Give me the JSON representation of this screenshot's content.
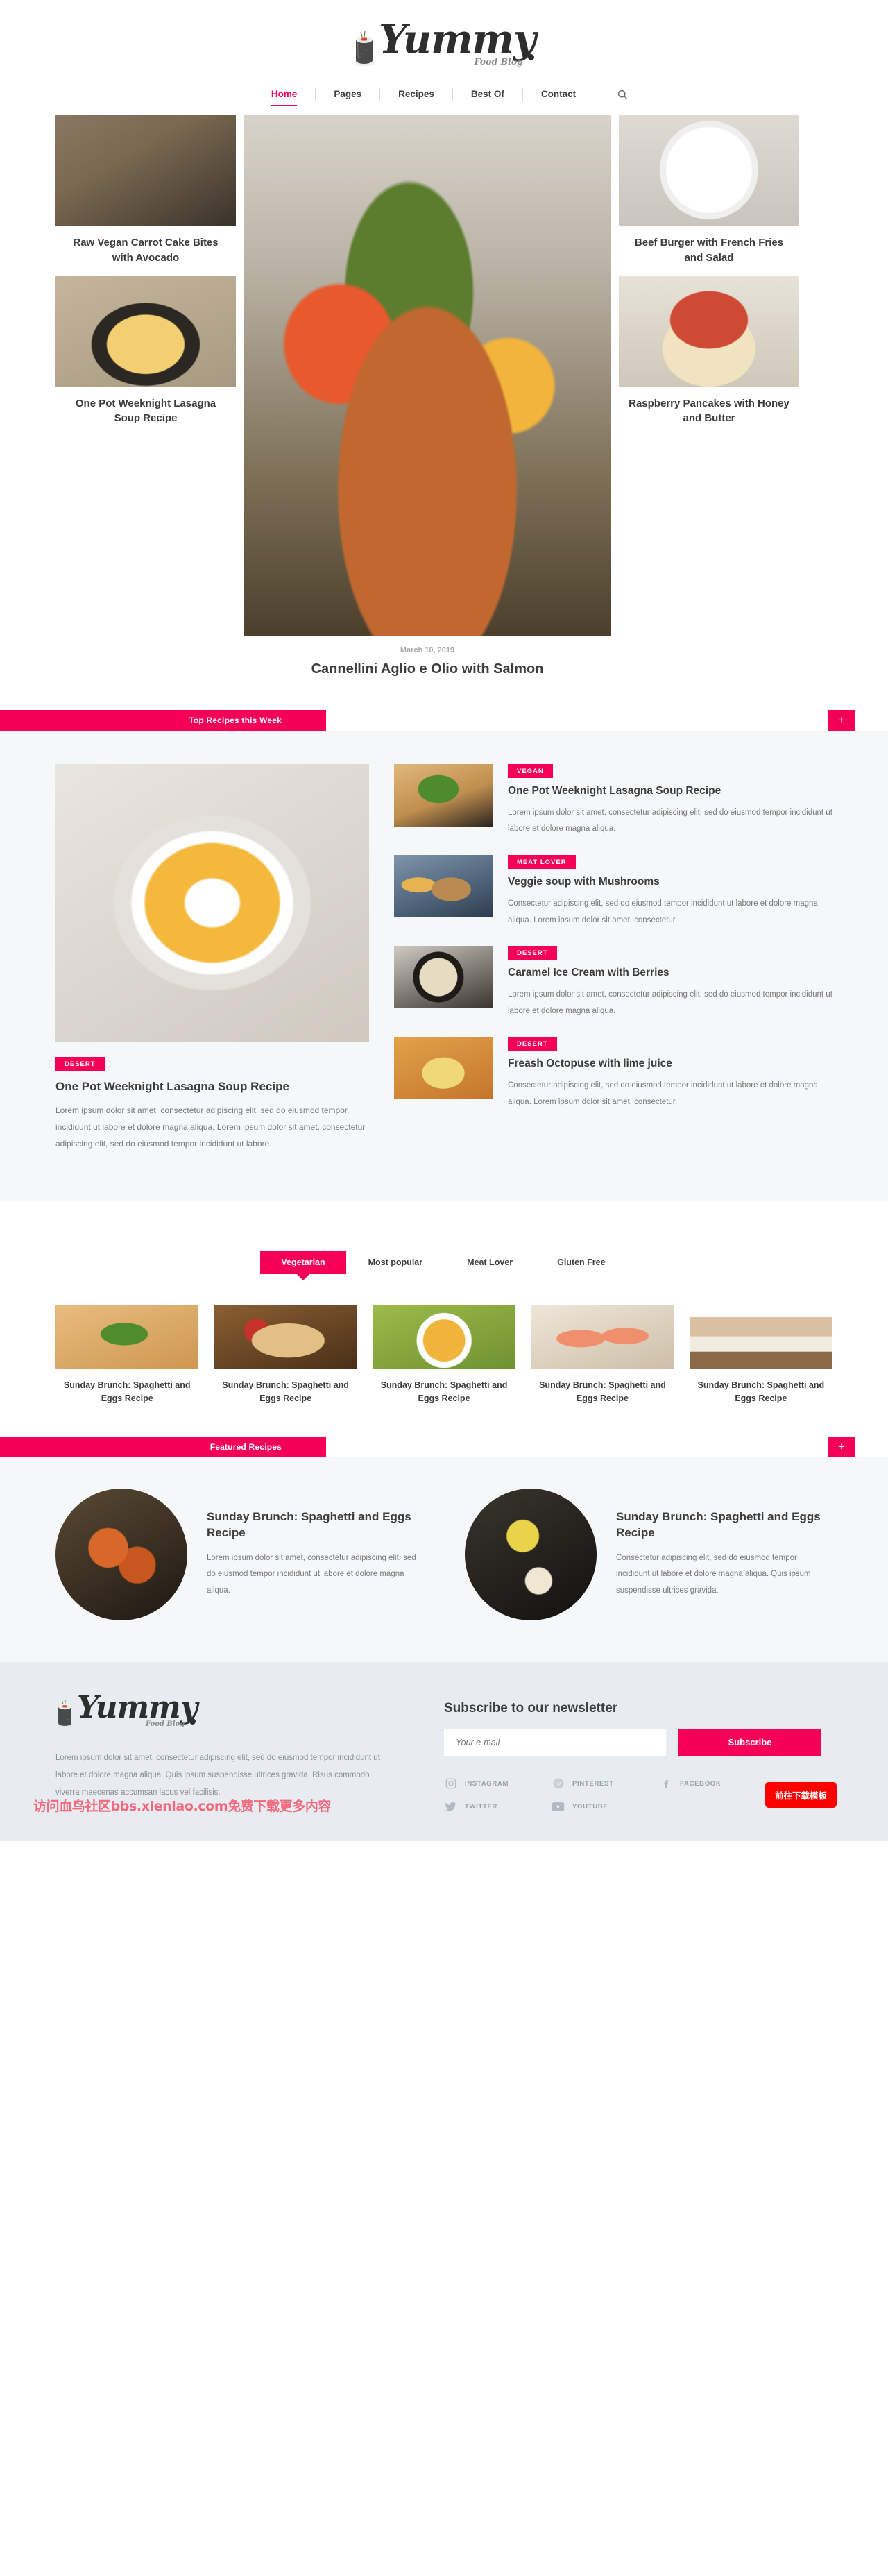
{
  "brand": {
    "name": "Yummy",
    "tagline": "Food Blog",
    "logo_icon": "sushi-roll-icon"
  },
  "nav": {
    "items": [
      {
        "label": "Home",
        "active": true
      },
      {
        "label": "Pages",
        "active": false
      },
      {
        "label": "Recipes",
        "active": false
      },
      {
        "label": "Best Of",
        "active": false
      },
      {
        "label": "Contact",
        "active": false
      }
    ],
    "search_icon": "search-icon"
  },
  "hero": {
    "left": [
      {
        "title": "Raw Vegan Carrot Cake Bites with Avocado",
        "img": "pancakes-raspberries"
      },
      {
        "title": "One Pot Weeknight Lasagna Soup Recipe",
        "img": "omelette-skillet"
      }
    ],
    "center": {
      "date": "March 10, 2019",
      "title": "Cannellini Aglio e Olio with Salmon",
      "img": "salmon-vegetables"
    },
    "right": [
      {
        "title": "Beef Burger with French Fries and Salad",
        "img": "gourmet-plate"
      },
      {
        "title": "Raspberry Pancakes with Honey and Butter",
        "img": "berry-charlotte-cake"
      }
    ]
  },
  "top_recipes": {
    "bar_label": "Top Recipes this Week",
    "plus_label": "+",
    "featured": {
      "tag": "DESERT",
      "title": "One Pot Weeknight Lasagna Soup Recipe",
      "text": "Lorem ipsum dolor sit amet, consectetur adipiscing elit, sed do eiusmod tempor incididunt ut labore et dolore magna aliqua. Lorem ipsum dolor sit amet, consectetur adipiscing elit, sed do eiusmod tempor incididunt ut labore.",
      "img": "pumpkin-soup-bowl"
    },
    "items": [
      {
        "tag": "VEGAN",
        "title": "One Pot Weeknight Lasagna Soup Recipe",
        "text": "Lorem ipsum dolor sit amet, consectetur adipiscing elit, sed do eiusmod tempor incididunt ut labore et dolore magna aliqua.",
        "img": "burger-basil"
      },
      {
        "tag": "MEAT LOVER",
        "title": "Veggie soup with Mushrooms",
        "text": "Consectetur adipiscing elit, sed do eiusmod tempor incididunt ut labore et dolore magna aliqua. Lorem ipsum dolor sit amet, consectetur.",
        "img": "burger-fries-tray"
      },
      {
        "tag": "DESERT",
        "title": "Caramel Ice Cream with Berries",
        "text": "Lorem ipsum dolor sit amet, consectetur adipiscing elit, sed do eiusmod tempor incididunt ut labore et dolore magna aliqua.",
        "img": "oat-bowl-strawberry"
      },
      {
        "tag": "DESERT",
        "title": "Freash Octopuse with lime juice",
        "text": "Consectetur adipiscing elit, sed do eiusmod tempor incididunt ut labore et dolore magna aliqua. Lorem ipsum dolor sit amet, consectetur.",
        "img": "rice-bowl-scallions"
      }
    ]
  },
  "categories": {
    "tabs": [
      {
        "label": "Vegetarian",
        "active": true
      },
      {
        "label": "Most popular",
        "active": false
      },
      {
        "label": "Meat Lover",
        "active": false
      },
      {
        "label": "Gluten Free",
        "active": false
      }
    ],
    "cards": [
      {
        "title": "Sunday Brunch: Spaghetti and Eggs Recipe",
        "img": "sandwich-basil"
      },
      {
        "title": "Sunday Brunch: Spaghetti and Eggs Recipe",
        "img": "pizza-board"
      },
      {
        "title": "Sunday Brunch: Spaghetti and Eggs Recipe",
        "img": "pumpkin-soup-green"
      },
      {
        "title": "Sunday Brunch: Spaghetti and Eggs Recipe",
        "img": "salmon-canapes"
      },
      {
        "title": "Sunday Brunch: Spaghetti and Eggs Recipe",
        "img": "tiramisu-slice"
      }
    ]
  },
  "featured_recipes": {
    "bar_label": "Featured Recipes",
    "plus_label": "+",
    "cards": [
      {
        "title": "Sunday Brunch: Spaghetti and Eggs Recipe",
        "text": "Lorem ipsum dolor sit amet, consectetur adipiscing elit, sed do eiusmod tempor incididunt ut labore et dolore magna aliqua.",
        "img": "stuffed-tomatoes-dark"
      },
      {
        "title": "Sunday Brunch: Spaghetti and Eggs Recipe",
        "text": "Consectetur adipiscing elit, sed do eiusmod tempor incididunt ut labore et dolore magna aliqua. Quis ipsum suspendisse ultrices gravida.",
        "img": "dark-plate-flowers"
      }
    ]
  },
  "footer": {
    "about_text": "Lorem ipsum dolor sit amet, consectetur adipiscing elit, sed do eiusmod tempor incididunt ut labore et dolore magna aliqua. Quis ipsum suspendisse ultrices gravida. Risus commodo viverra maecenas accumsan lacus vel facilisis.",
    "newsletter_title": "Subscribe to our newsletter",
    "email_placeholder": "Your e-mail",
    "email_value": "",
    "subscribe_label": "Subscribe",
    "social": [
      {
        "label": "INSTAGRAM",
        "icon": "instagram-icon"
      },
      {
        "label": "PINTEREST",
        "icon": "pinterest-icon"
      },
      {
        "label": "FACEBOOK",
        "icon": "facebook-icon"
      },
      {
        "label": "TWITTER",
        "icon": "twitter-icon"
      },
      {
        "label": "YOUTUBE",
        "icon": "youtube-icon"
      }
    ],
    "watermark": "访问血鸟社区bbs.xlenlao.com免费下载更多内容",
    "download_button": "前往下载模板"
  },
  "colors": {
    "accent": "#f50057",
    "text": "#3d3d3d",
    "muted": "#7b7b7b",
    "section_bg": "#f6f7f9",
    "footer_bg": "#e8ecf1",
    "download_red": "#ff0000"
  }
}
